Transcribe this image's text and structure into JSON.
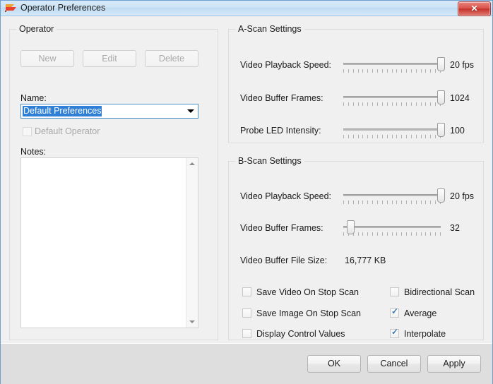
{
  "window": {
    "title": "Operator Preferences",
    "icon": "flag-icon",
    "close_label": "✕"
  },
  "operator_group": {
    "title": "Operator",
    "buttons": [
      {
        "name": "new",
        "label": "New",
        "disabled": true
      },
      {
        "name": "edit",
        "label": "Edit",
        "disabled": true
      },
      {
        "name": "delete",
        "label": "Delete",
        "disabled": true
      }
    ],
    "name_label": "Name:",
    "name_value": "Default Preferences",
    "default_operator_label": "Default Operator",
    "default_operator_checked": false,
    "default_operator_disabled": true,
    "notes_label": "Notes:",
    "notes_value": ""
  },
  "ascan_group": {
    "title": "A-Scan Settings",
    "sliders": [
      {
        "name": "video-playback-speed",
        "label": "Video Playback Speed:",
        "value": "20  fps",
        "percent": 100
      },
      {
        "name": "video-buffer-frames",
        "label": "Video Buffer Frames:",
        "value": "1024",
        "percent": 100
      },
      {
        "name": "probe-led-intensity",
        "label": "Probe LED Intensity:",
        "value": "100",
        "percent": 100
      }
    ]
  },
  "bscan_group": {
    "title": "B-Scan Settings",
    "sliders": [
      {
        "name": "video-playback-speed",
        "label": "Video Playback Speed:",
        "value": "20  fps",
        "percent": 100
      },
      {
        "name": "video-buffer-frames",
        "label": "Video Buffer Frames:",
        "value": "32",
        "percent": 7
      }
    ],
    "file_size_label": "Video Buffer File Size:",
    "file_size_value": "16,777 KB",
    "checkboxes_left": [
      {
        "name": "save-video-on-stop-scan",
        "label": "Save Video On Stop Scan",
        "checked": false
      },
      {
        "name": "save-image-on-stop-scan",
        "label": "Save Image On Stop Scan",
        "checked": false
      },
      {
        "name": "display-control-values",
        "label": "Display Control Values",
        "checked": false
      }
    ],
    "checkboxes_right": [
      {
        "name": "bidirectional-scan",
        "label": "Bidirectional Scan",
        "checked": false
      },
      {
        "name": "average",
        "label": "Average",
        "checked": true
      },
      {
        "name": "interpolate",
        "label": "Interpolate",
        "checked": true
      }
    ],
    "check_glyph": "✓"
  },
  "footer": {
    "ok_label": "OK",
    "cancel_label": "Cancel",
    "apply_label": "Apply"
  },
  "colors": {
    "accent": "#2f7fd6",
    "titlebar": "#cde3f5",
    "close": "#c5332c",
    "check": "#3a79b8",
    "window_bg": "#f0f0f0",
    "footer_bg": "#dedede"
  }
}
